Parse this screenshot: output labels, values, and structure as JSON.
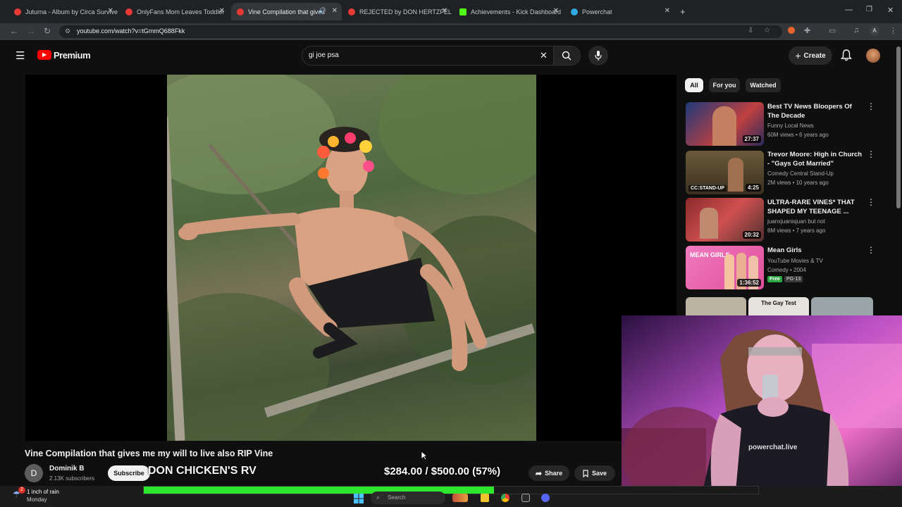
{
  "browser": {
    "tabs": [
      {
        "label": "Juturna - Album by Circa Survive",
        "color": "#e53935",
        "active": false
      },
      {
        "label": "OnlyFans Mom Leaves Toddler",
        "color": "#e53935",
        "active": false
      },
      {
        "label": "Vine Compilation that gives",
        "color": "#e53935",
        "active": true
      },
      {
        "label": "REJECTED by DON HERTZFELDT",
        "color": "#e53935",
        "active": false
      },
      {
        "label": "Achievements - Kick Dashboard",
        "color": "#53fc18",
        "active": false
      },
      {
        "label": "Powerchat",
        "color": "#2fa9e0",
        "active": false
      }
    ],
    "url": "youtube.com/watch?v=tGmmQ688Fkk",
    "profile_initial": "A"
  },
  "youtube": {
    "logo_text": "Premium",
    "search_value": "gi joe psa",
    "create_label": "Create"
  },
  "video": {
    "title": "Vine Compilation that gives me my will to live also RIP Vine",
    "channel_name": "Dominik B",
    "channel_initial": "D",
    "subscribers": "2.13K subscribers",
    "subscribe_label": "Subscribe",
    "share_label": "Share",
    "save_label": "Save"
  },
  "sidebar": {
    "chips": [
      "All",
      "For you",
      "Watched"
    ],
    "items": [
      {
        "title": "Best TV News Bloopers Of The Decade",
        "channel": "Funny Local News",
        "meta": "60M views • 6 years ago",
        "duration": "27:37",
        "thumb": "#5a2a2a"
      },
      {
        "title": "Trevor Moore: High in Church - \"Gays Got Married\"",
        "channel": "Comedy Central Stand-Up",
        "meta": "2M views • 10 years ago",
        "duration": "4:25",
        "badge": "CC:STAND-UP",
        "thumb": "#5a4a2a"
      },
      {
        "title": "ULTRA-RARE VINES* THAT SHAPED MY TEENAGE ...",
        "channel": "juanxjuanisjuan but not",
        "meta": "6M views • 7 years ago",
        "duration": "20:32",
        "thumb": "#6a3a3a"
      },
      {
        "title": "Mean Girls",
        "channel": "YouTube Movies & TV",
        "meta": "Comedy • 2004",
        "duration": "1:36:52",
        "free_label": "Free",
        "rating": "PG-13",
        "thumb": "#e66fb0"
      }
    ],
    "shorts_label": "The Gay Test"
  },
  "overlay": {
    "ticker_text": "DON CHICKEN'S RV",
    "goal_text": "$284.00 / $500.00 (57%)",
    "goal_fraction": 0.57,
    "goal_color": "#2ee62e",
    "webcam_brand": "powerchat.live"
  },
  "taskbar": {
    "weather_text": "1 inch of rain",
    "day_text": "Monday",
    "weather_badge": "2",
    "search_placeholder": "Search"
  }
}
